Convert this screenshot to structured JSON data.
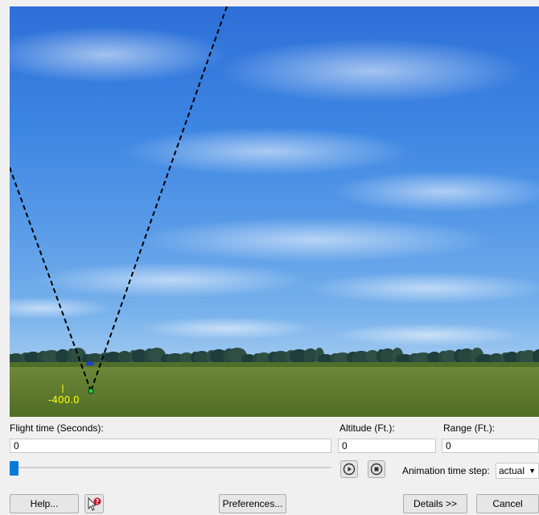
{
  "scene": {
    "altitude_marker": "-400.0",
    "marker_color": "#ffff00",
    "sky_color": "#3d86e3",
    "ground_color": "#5d7a2c"
  },
  "controls": {
    "flight_time_label": "Flight time (Seconds):",
    "altitude_label": "Altitude (Ft.):",
    "range_label": "Range (Ft.):",
    "flight_time_value": "0",
    "altitude_value": "0",
    "range_value": "0",
    "slider_position": 0,
    "play_icon": "play-icon",
    "stop_icon": "stop-icon",
    "animation_step_label": "Animation time step:",
    "animation_step_value": "actual"
  },
  "buttons": {
    "help": "Help...",
    "preferences": "Preferences...",
    "details": "Details >>",
    "cancel": "Cancel",
    "context_help_icon": "whats-this-help-icon"
  },
  "colors": {
    "accent": "#0a7ad8"
  }
}
